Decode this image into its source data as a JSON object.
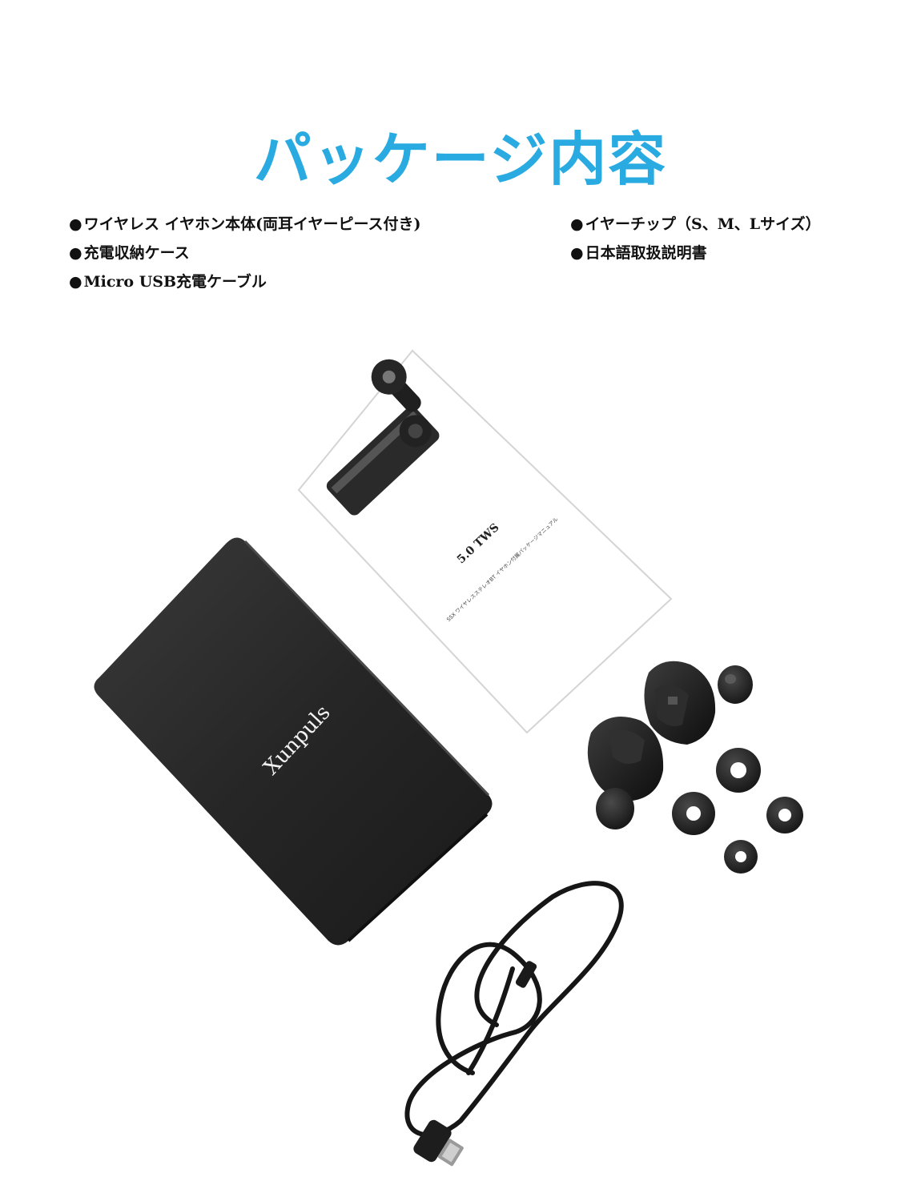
{
  "title": "パッケージ内容",
  "bullet_glyph": "●",
  "contents_left": [
    "ワイヤレス イヤホン本体(両耳イヤーピース付き)",
    "充電収納ケース",
    "Micro USB充電ケーブル"
  ],
  "contents_right": [
    "イヤーチップ（S、M、Lサイズ）",
    "日本語取扱説明書"
  ],
  "manual": {
    "model": "5.0 TWS",
    "subtitle": "SSX ワイヤレスステレオBT イヤホン付属パッケージマニュアル"
  },
  "case_brand": "Xunpuls",
  "colors": {
    "title": "#29abe2",
    "text": "#111111",
    "case": "#2b2b2b",
    "earbud": "#1c1c1c"
  }
}
